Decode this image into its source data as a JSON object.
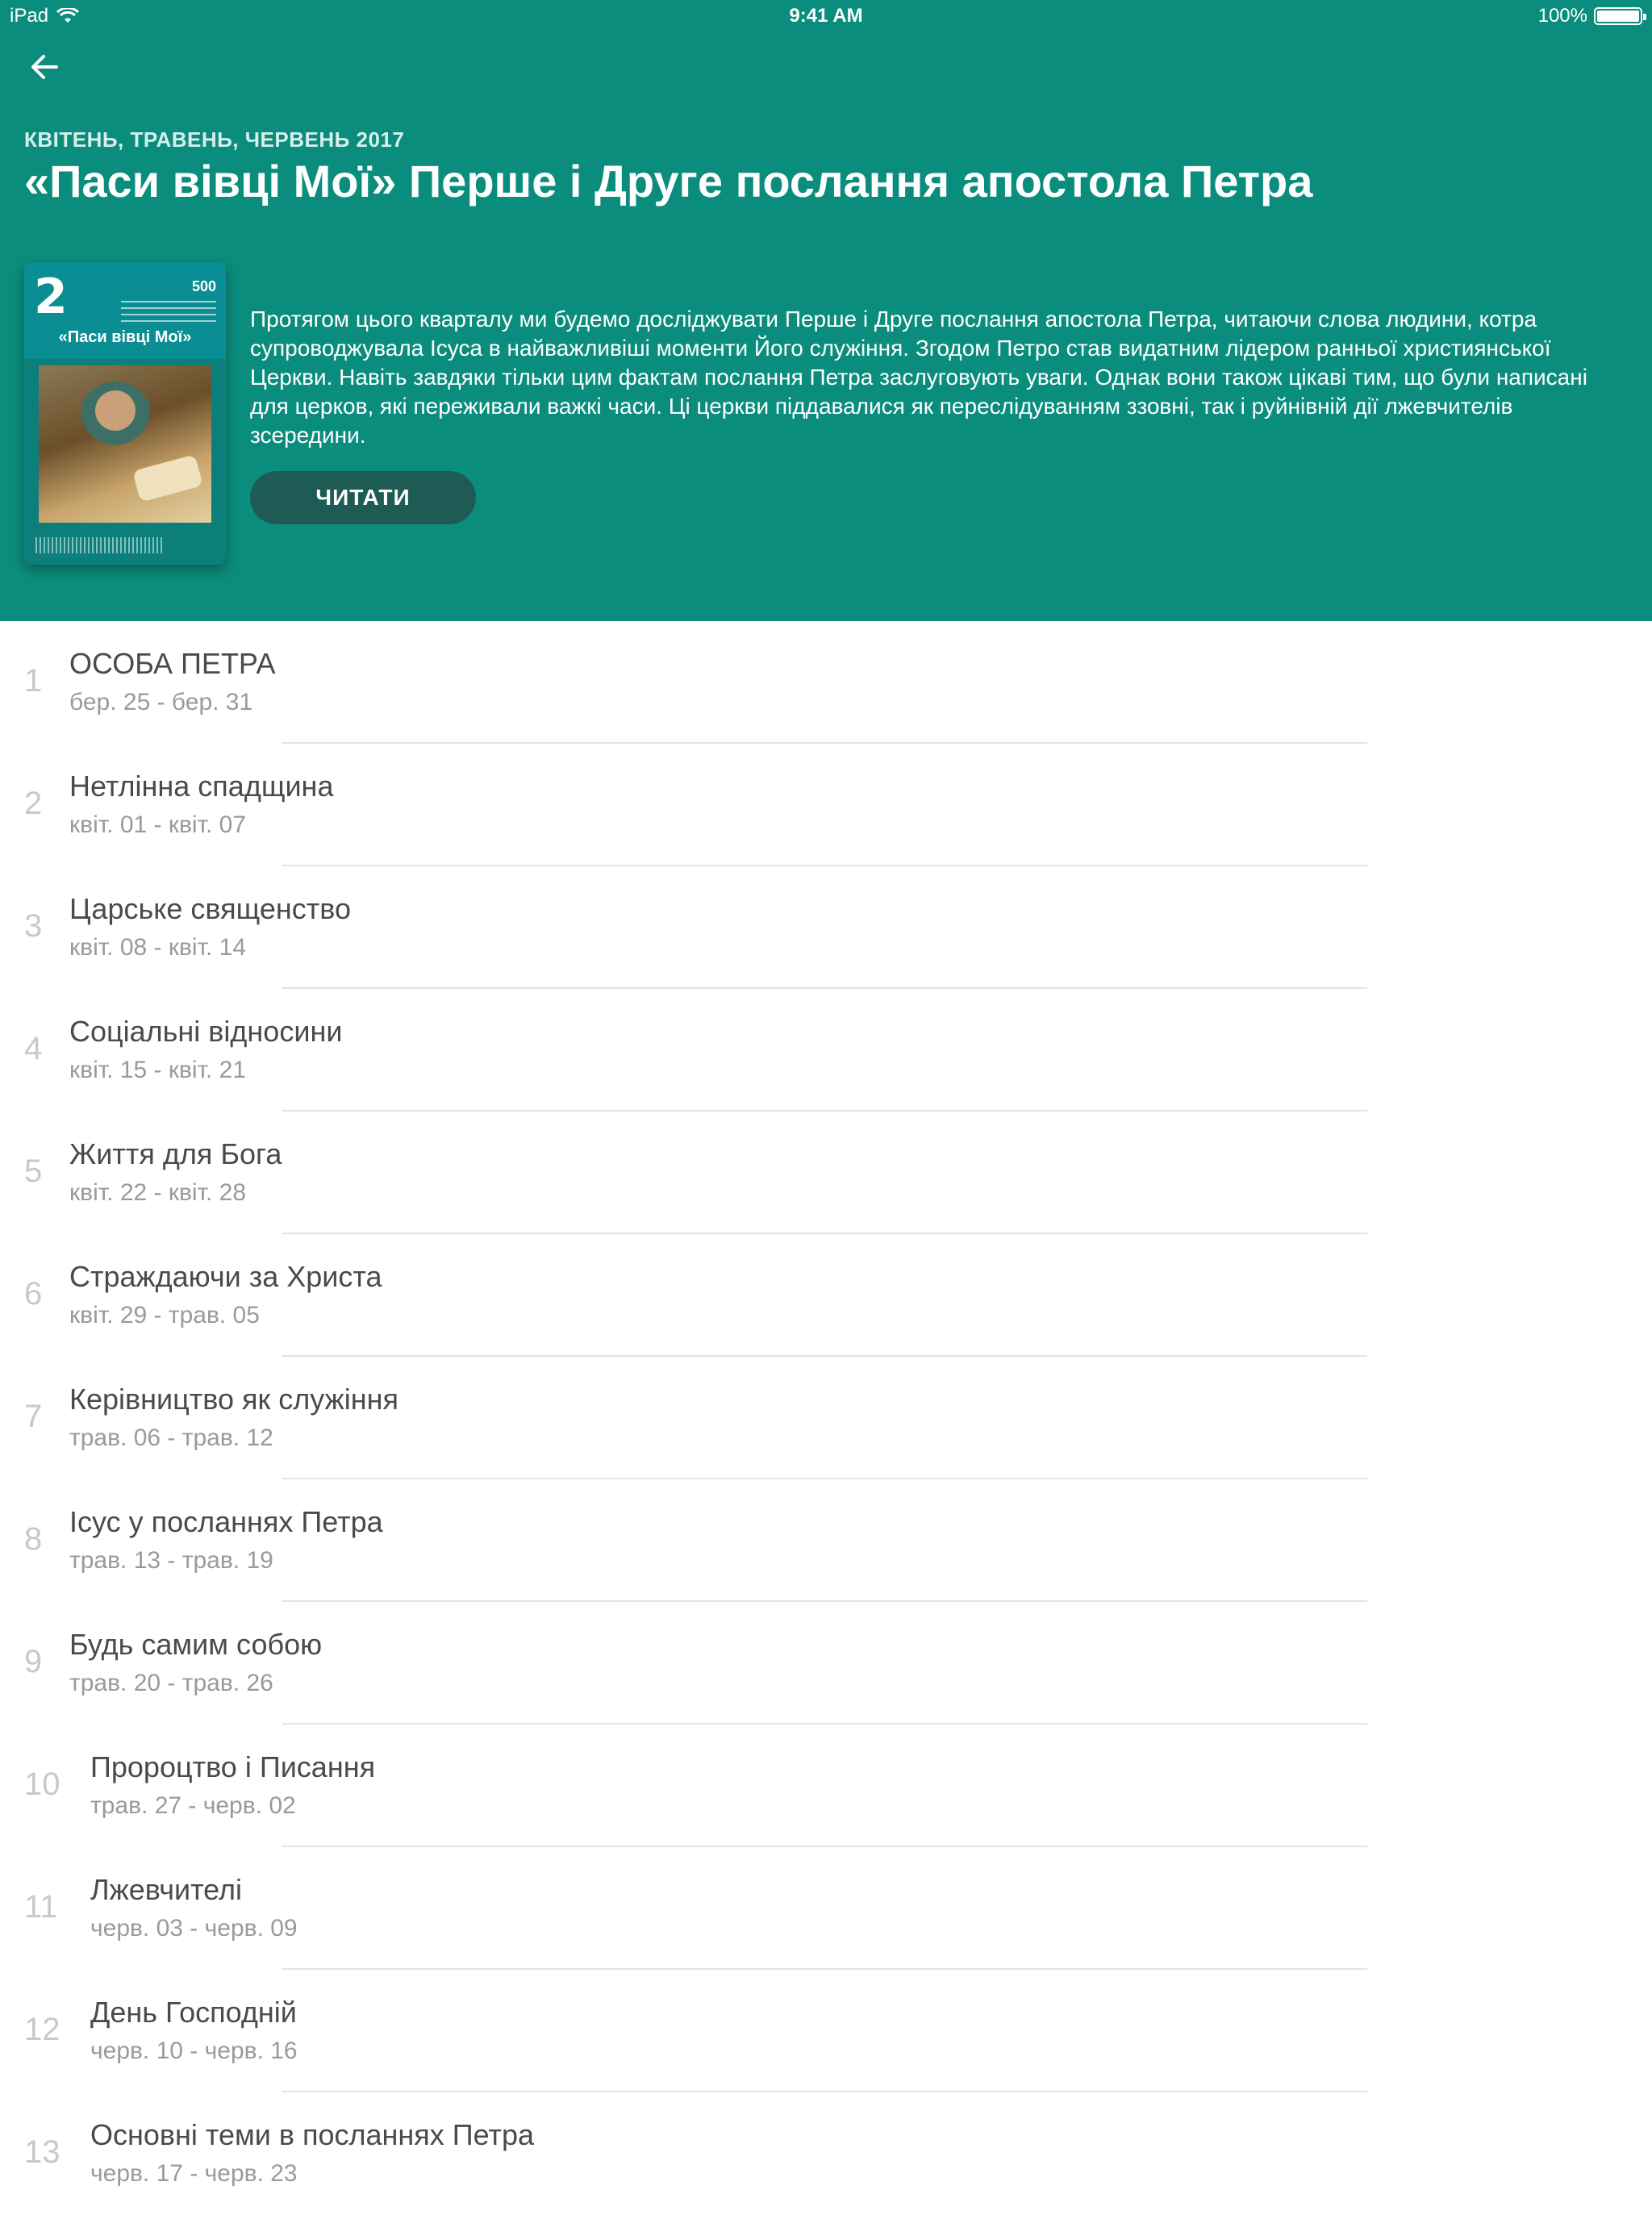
{
  "status_bar": {
    "device": "iPad",
    "time": "9:41 AM",
    "battery": "100%"
  },
  "header": {
    "quarter": "КВІТЕНЬ, ТРАВЕНЬ, ЧЕРВЕНЬ 2017",
    "title": "«Паси вівці Мої» Перше і Друге послання апостола Петра",
    "description": "Протягом цього кварталу ми будемо досліджувати Перше і Друге послання апостола Петра, читаючи слова людини, котра супроводжувала Ісуса в найважливіші моменти Його служіння. Згодом Петро став видатним лідером ранньої християнської Церкви. Навіть завдяки тільки цим фактам послання Петра заслуговують уваги. Однак вони також цікаві тим, що були написані для церков, які переживали важкі часи. Ці церкви піддавалися як переслідуванням ззовні, так і руйнівній дії лжевчителів зсередини.",
    "read_button": "ЧИТАТИ",
    "cover": {
      "number": "2",
      "badge": "500",
      "title": "«Паси вівці Мої»"
    }
  },
  "lessons": [
    {
      "num": "1",
      "title": "ОСОБА ПЕТРА",
      "dates": "бер. 25 - бер. 31"
    },
    {
      "num": "2",
      "title": "Нетлінна спадщина",
      "dates": "квіт. 01 - квіт. 07"
    },
    {
      "num": "3",
      "title": "Царське священство",
      "dates": "квіт. 08 - квіт. 14"
    },
    {
      "num": "4",
      "title": "Соціальні відносини",
      "dates": "квіт. 15 - квіт. 21"
    },
    {
      "num": "5",
      "title": "Життя для Бога",
      "dates": "квіт. 22 - квіт. 28"
    },
    {
      "num": "6",
      "title": "Страждаючи за Христа",
      "dates": "квіт. 29 - трав. 05"
    },
    {
      "num": "7",
      "title": "Керівництво як служіння",
      "dates": "трав. 06 - трав. 12"
    },
    {
      "num": "8",
      "title": "Ісус у посланнях Петра",
      "dates": "трав. 13 - трав. 19"
    },
    {
      "num": "9",
      "title": "Будь самим собою",
      "dates": "трав. 20 - трав. 26"
    },
    {
      "num": "10",
      "title": "Пророцтво і Писання",
      "dates": "трав. 27 - черв. 02"
    },
    {
      "num": "11",
      "title": "Лжевчителі",
      "dates": "черв. 03 - черв. 09"
    },
    {
      "num": "12",
      "title": "День Господній",
      "dates": "черв. 10 - черв. 16"
    },
    {
      "num": "13",
      "title": "Основні теми в посланнях Петра",
      "dates": "черв. 17 - черв. 23"
    }
  ],
  "colors": {
    "header_bg": "#0b8d7d",
    "button_bg": "#1e5b54",
    "number": "#c9c9c9",
    "title": "#4a4a4a",
    "dates": "#9a9a9a"
  }
}
